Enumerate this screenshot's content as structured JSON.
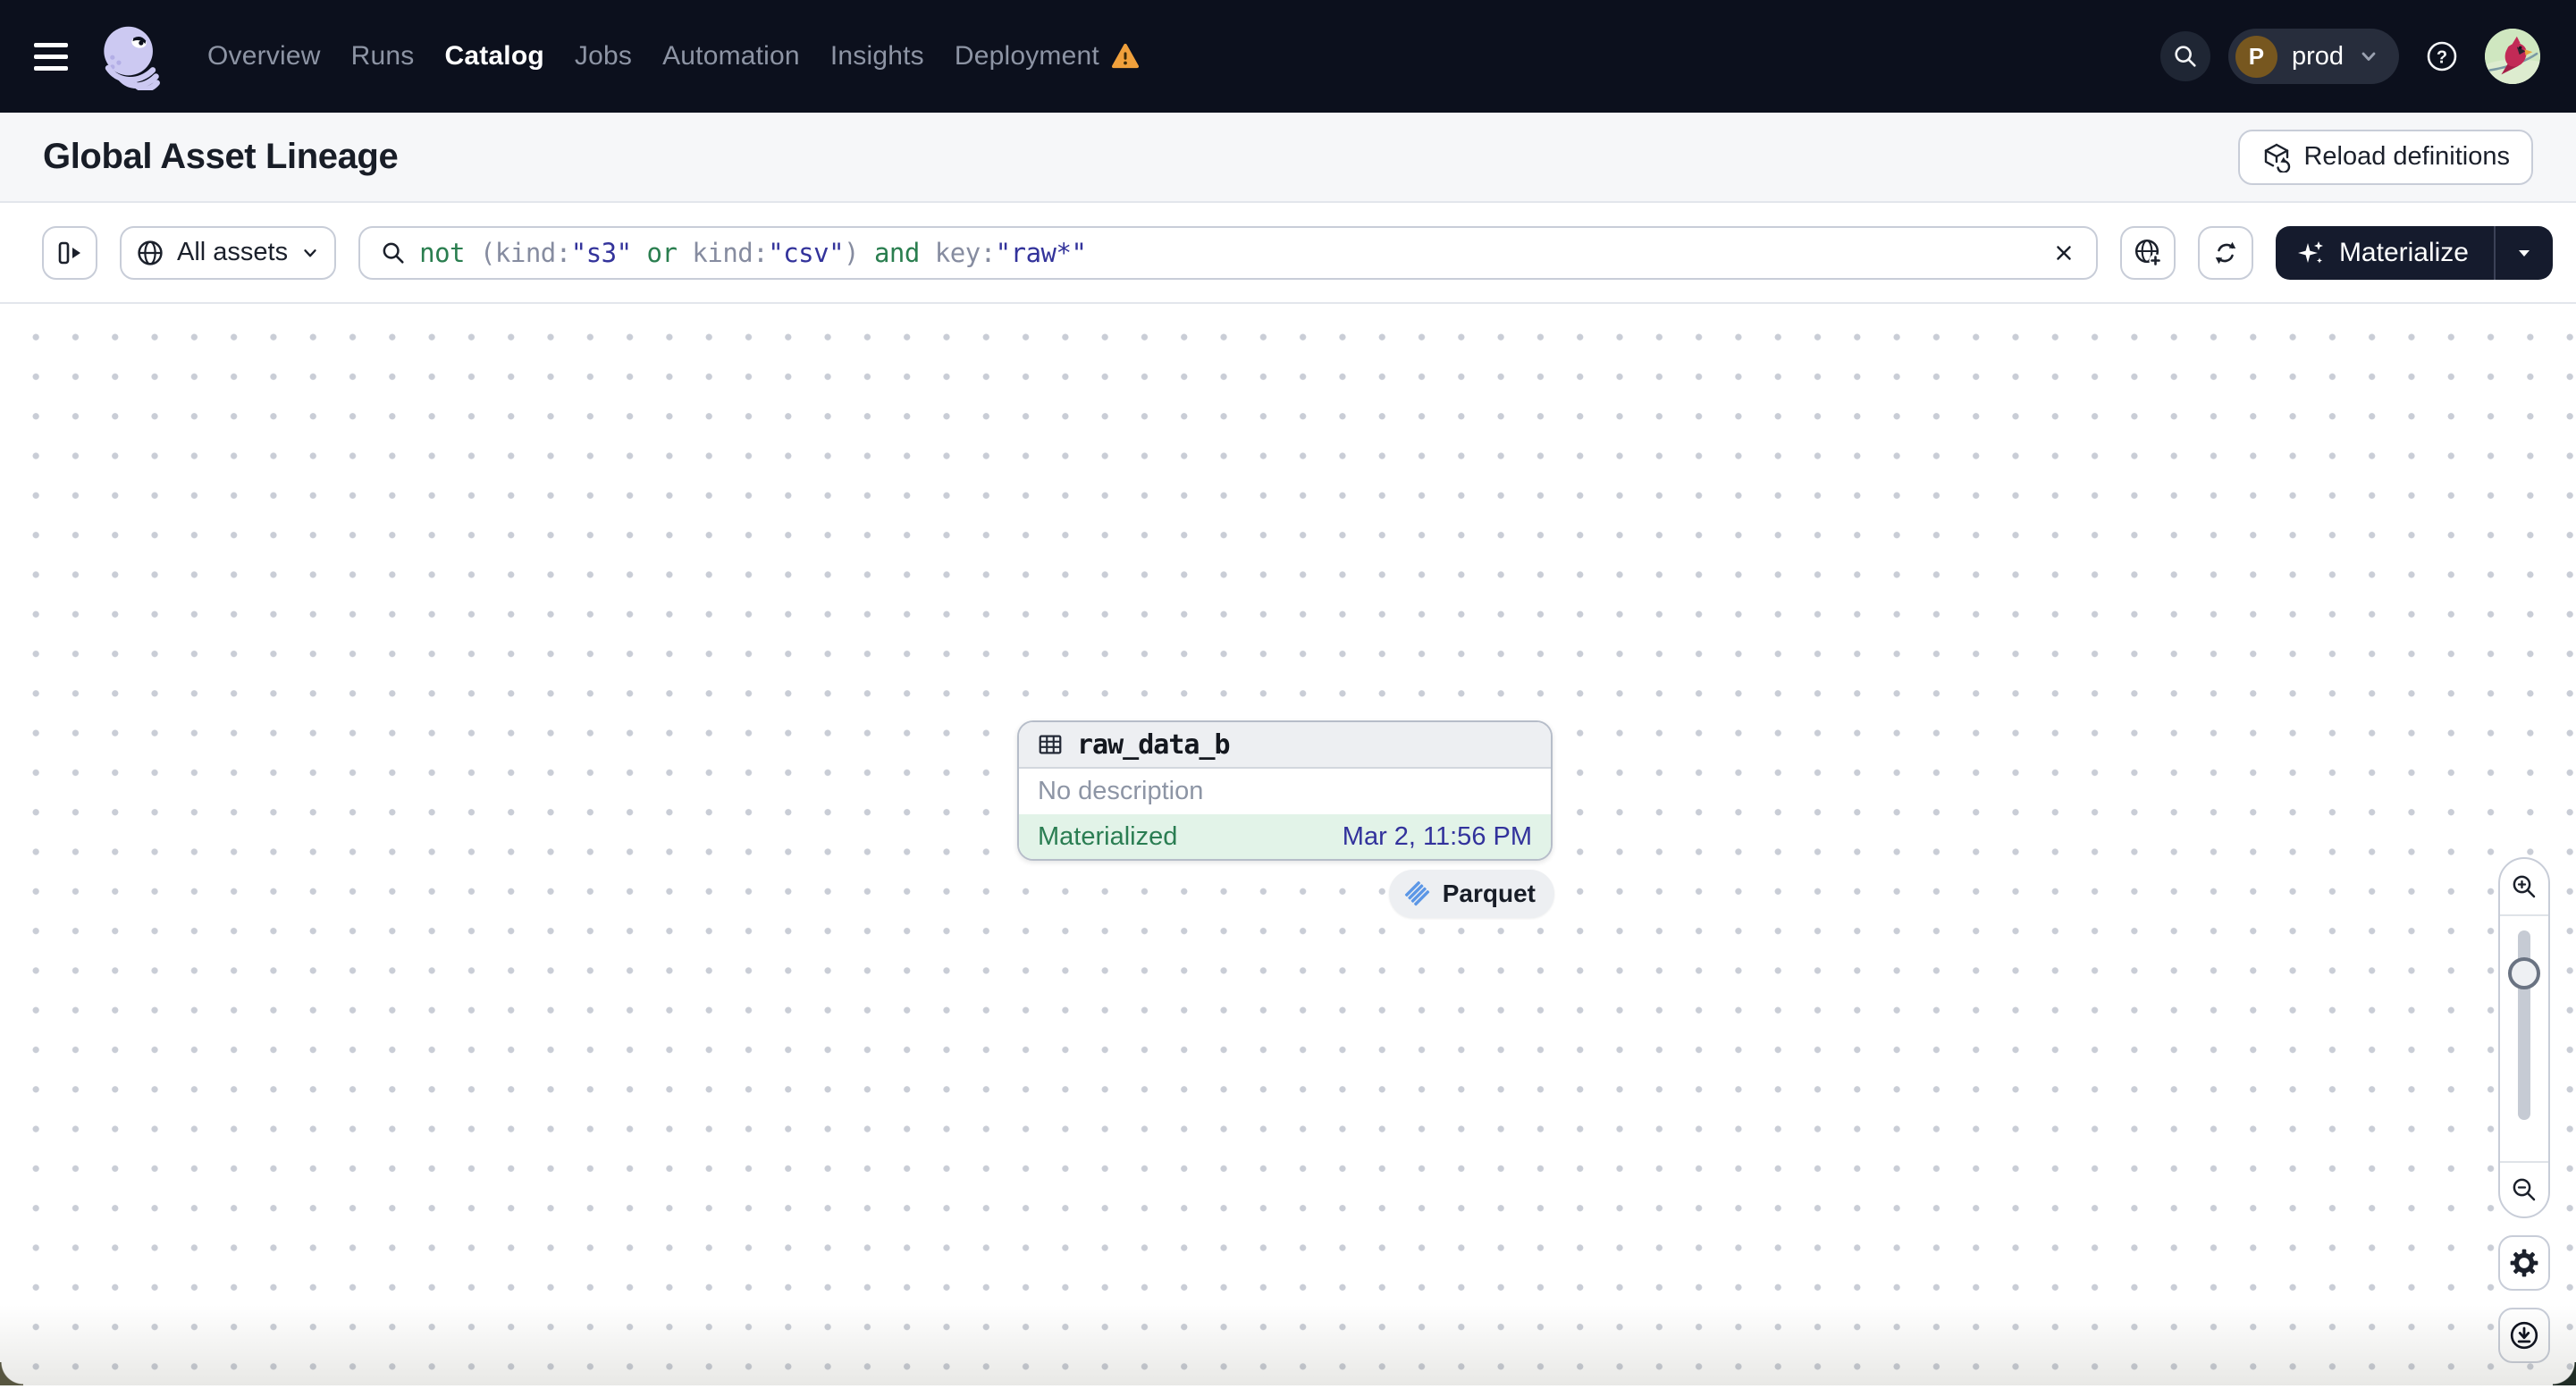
{
  "nav": {
    "items": [
      {
        "label": "Overview"
      },
      {
        "label": "Runs"
      },
      {
        "label": "Catalog",
        "active": true
      },
      {
        "label": "Jobs"
      },
      {
        "label": "Automation"
      },
      {
        "label": "Insights"
      },
      {
        "label": "Deployment",
        "warning": true
      }
    ],
    "environment": {
      "initial": "P",
      "name": "prod"
    }
  },
  "header": {
    "title": "Global Asset Lineage",
    "reload_label": "Reload definitions"
  },
  "toolbar": {
    "scope_label": "All assets",
    "query": {
      "full_text": "not (kind:\"s3\" or kind:\"csv\") and key:\"raw*\"",
      "tokens": [
        {
          "text": "not ",
          "type": "keyword"
        },
        {
          "text": "(",
          "type": "field"
        },
        {
          "text": "kind:",
          "type": "field"
        },
        {
          "text": "\"s3\"",
          "type": "string"
        },
        {
          "text": " or ",
          "type": "keyword"
        },
        {
          "text": "kind:",
          "type": "field"
        },
        {
          "text": "\"csv\"",
          "type": "string"
        },
        {
          "text": ")",
          "type": "field"
        },
        {
          "text": " and ",
          "type": "keyword"
        },
        {
          "text": "key:",
          "type": "field"
        },
        {
          "text": "\"raw*\"",
          "type": "string"
        }
      ]
    },
    "materialize_label": "Materialize"
  },
  "graph": {
    "node": {
      "name": "raw_data_b",
      "description": "No description",
      "status": "Materialized",
      "timestamp": "Mar 2, 11:56 PM",
      "kind": "Parquet"
    }
  },
  "colors": {
    "nav_bg": "#0c101d",
    "accent_green": "#2a7d52",
    "status_bg_green": "#e2f3e8",
    "timestamp_navy": "#32329c",
    "query_keyword": "#2a7e4f",
    "query_string": "#33339b",
    "warning_orange": "#f0a03c",
    "parquet_blue": "#5c97e6",
    "materialize_bg": "#151b2d"
  }
}
